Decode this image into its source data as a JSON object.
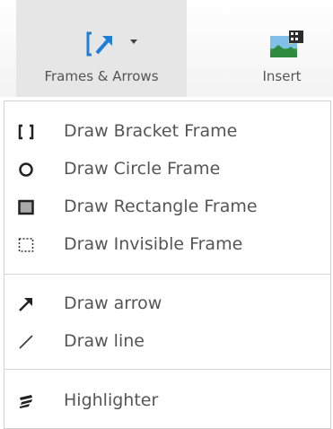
{
  "toolbar": {
    "frames_label": "Frames & Arrows",
    "insert_label": "Insert"
  },
  "menu": {
    "items": [
      {
        "label": "Draw Bracket Frame",
        "icon": "bracket-frame-icon"
      },
      {
        "label": "Draw Circle Frame",
        "icon": "circle-frame-icon"
      },
      {
        "label": "Draw Rectangle Frame",
        "icon": "rectangle-frame-icon"
      },
      {
        "label": "Draw Invisible Frame",
        "icon": "invisible-frame-icon"
      },
      {
        "label": "Draw arrow",
        "icon": "arrow-icon"
      },
      {
        "label": "Draw line",
        "icon": "line-icon"
      },
      {
        "label": "Highlighter",
        "icon": "highlighter-icon"
      }
    ]
  },
  "colors": {
    "accent_blue": "#1e7fd8",
    "selected_button_bg": "#e6e6e6",
    "text": "#555555"
  }
}
